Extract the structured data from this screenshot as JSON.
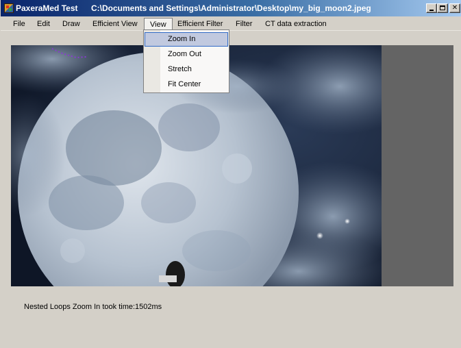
{
  "window": {
    "app_title": "PaxeraMed Test",
    "file_path": "C:\\Documents and Settings\\Administrator\\Desktop\\my_big_moon2.jpeg"
  },
  "title_bar": {
    "minimize_glyph": "_",
    "maximize_glyph": "□",
    "close_glyph": "✕"
  },
  "menu": {
    "items": [
      {
        "label": "File"
      },
      {
        "label": "Edit"
      },
      {
        "label": "Draw"
      },
      {
        "label": "Efficient View"
      },
      {
        "label": "View"
      },
      {
        "label": "Efficient Filter"
      },
      {
        "label": "Filter"
      },
      {
        "label": "CT data extraction"
      }
    ],
    "open_menu": "View"
  },
  "view_menu": {
    "items": [
      {
        "label": "Zoom In",
        "highlighted": true
      },
      {
        "label": "Zoom Out"
      },
      {
        "label": "Stretch"
      },
      {
        "label": "Fit  Center"
      }
    ]
  },
  "status": {
    "text": "Nested Loops Zoom In took time:1502ms"
  },
  "colors": {
    "title_gradient_start": "#0a246a",
    "title_gradient_end": "#a6caf0",
    "window_bg": "#d4d0c8",
    "image_panel_bg": "#646464",
    "menu_highlight": "#c1c9df",
    "menu_highlight_border": "#316ac5"
  }
}
